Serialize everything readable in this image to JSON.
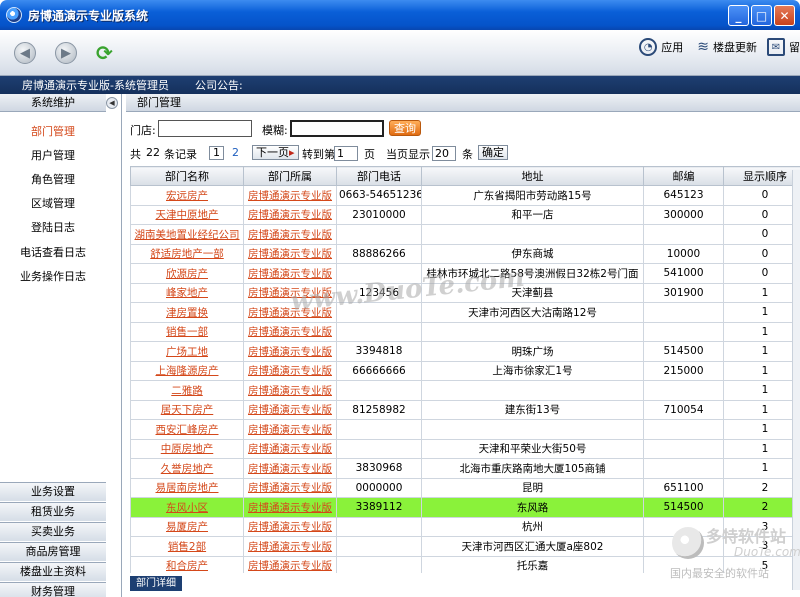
{
  "window": {
    "title": "房博通演示专业版系统"
  },
  "toolbar": {
    "apps_label": "应用",
    "update_label": "楼盘更新",
    "msg_label": "留"
  },
  "infobar": {
    "system_label": "房博通演示专业版-系统管理员",
    "notice_label": "公司公告:"
  },
  "sidebar": {
    "header": "系统维护",
    "items": [
      "部门管理",
      "用户管理",
      "角色管理",
      "区域管理",
      "登陆日志",
      "电话查看日志",
      "业务操作日志"
    ],
    "categories": [
      "业务设置",
      "租赁业务",
      "买卖业务",
      "商品房管理",
      "楼盘业主资料",
      "财务管理"
    ]
  },
  "main": {
    "title": "部门管理",
    "filter": {
      "store_label": "门店:",
      "fuzzy_label": "模糊:",
      "query_button": "查询"
    },
    "pager": {
      "total_prefix": "共",
      "total": "22",
      "total_suffix": "条记录",
      "pages": [
        "1",
        "2"
      ],
      "next_label": "下一页",
      "goto_label": "转到第",
      "goto_value": "1",
      "page_label": "页",
      "per_page_label": "当页显示",
      "per_page_value": "20",
      "per_page_unit": "条",
      "confirm_label": "确定"
    },
    "columns": [
      "部门名称",
      "部门所属",
      "部门电话",
      "地址",
      "邮编",
      "显示顺序"
    ],
    "rows": [
      [
        "宏远房产",
        "房博通演示专业版",
        "0663-54651236",
        "广东省揭阳市劳动路15号",
        "645123",
        "0"
      ],
      [
        "天津中原地产",
        "房博通演示专业版",
        "23010000",
        "和平一店",
        "300000",
        "0"
      ],
      [
        "湖南美地置业经纪公司",
        "房博通演示专业版",
        "",
        "",
        "",
        "0"
      ],
      [
        "舒适房地产一部",
        "房博通演示专业版",
        "88886266",
        "伊东商城",
        "10000",
        "0"
      ],
      [
        "欣源房产",
        "房博通演示专业版",
        "",
        "桂林市环城北二路58号澳洲假日32栋2号门面",
        "541000",
        "0"
      ],
      [
        "峰家地产",
        "房博通演示专业版",
        "123456",
        "天津蓟县",
        "301900",
        "1"
      ],
      [
        "津房置换",
        "房博通演示专业版",
        "",
        "天津市河西区大沽南路12号",
        "",
        "1"
      ],
      [
        "销售一部",
        "房博通演示专业版",
        "",
        "",
        "",
        "1"
      ],
      [
        "广场工地",
        "房博通演示专业版",
        "3394818",
        "明珠广场",
        "514500",
        "1"
      ],
      [
        "上海隆源房产",
        "房博通演示专业版",
        "66666666",
        "上海市徐家汇1号",
        "215000",
        "1"
      ],
      [
        "二雅路",
        "房博通演示专业版",
        "",
        "",
        "",
        "1"
      ],
      [
        "居天下房产",
        "房博通演示专业版",
        "81258982",
        "建东街13号",
        "710054",
        "1"
      ],
      [
        "西安汇峰房产",
        "房博通演示专业版",
        "",
        "",
        "",
        "1"
      ],
      [
        "中原房地产",
        "房博通演示专业版",
        "",
        "天津和平荣业大街50号",
        "",
        "1"
      ],
      [
        "久誉房地产",
        "房博通演示专业版",
        "3830968",
        "北海市重庆路南地大厦105商铺",
        "",
        "1"
      ],
      [
        "易居南房地产",
        "房博通演示专业版",
        "0000000",
        "昆明",
        "651100",
        "2"
      ],
      [
        "东风小区",
        "房博通演示专业版",
        "3389112",
        "东风路",
        "514500",
        "2"
      ],
      [
        "易厦房产",
        "房博通演示专业版",
        "",
        "杭州",
        "",
        "3"
      ],
      [
        "销售2部",
        "房博通演示专业版",
        "",
        "天津市河西区汇通大厦a座802",
        "",
        "3"
      ],
      [
        "和合房产",
        "房博通演示专业版",
        "",
        "托乐嘉",
        "",
        "5"
      ]
    ],
    "highlighted_row": 16,
    "detail_tab": "部门详细"
  },
  "watermark": {
    "center_text": "www.DuoTe.com",
    "logo_title": "多特软件站",
    "logo_sub": "DuoTe.com",
    "logo_caption": "国内最安全的软件站"
  },
  "colors": {
    "link": "#d4481a",
    "highlight": "#8af23a",
    "titlebar": "#0a5fd8",
    "infobar": "#1e3f72"
  }
}
